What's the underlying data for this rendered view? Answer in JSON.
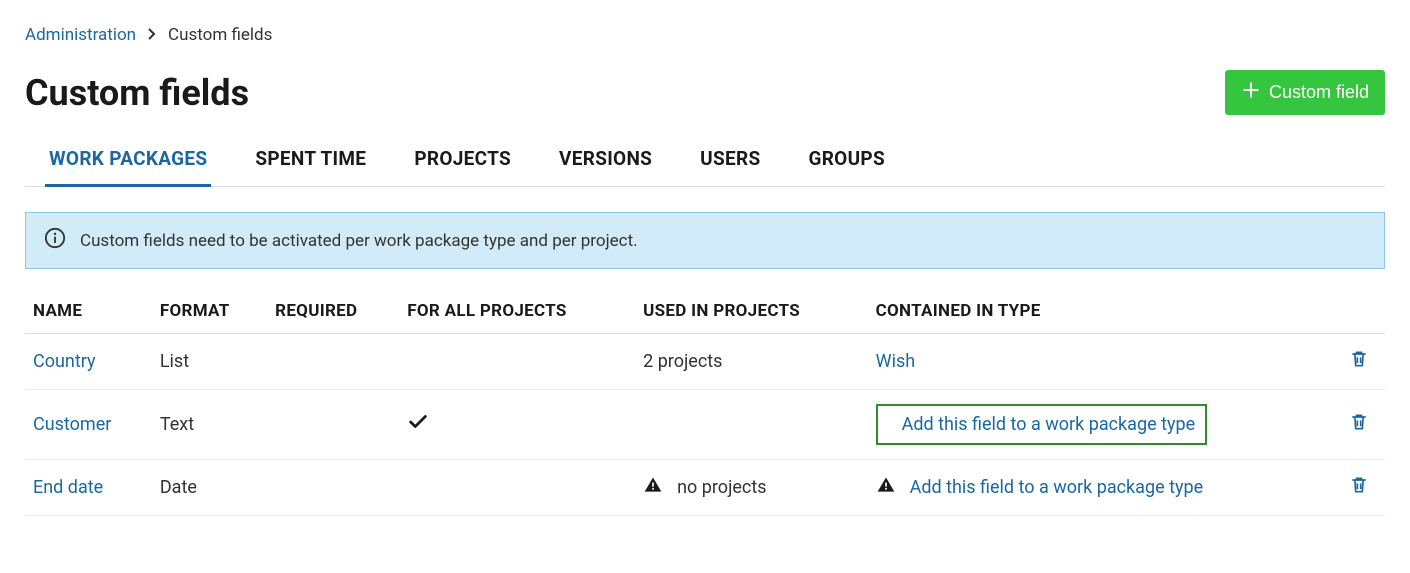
{
  "breadcrumb": {
    "parent": "Administration",
    "current": "Custom fields"
  },
  "page": {
    "title": "Custom fields",
    "add_button": "Custom field"
  },
  "tabs": [
    {
      "label": "WORK PACKAGES",
      "active": true
    },
    {
      "label": "SPENT TIME",
      "active": false
    },
    {
      "label": "PROJECTS",
      "active": false
    },
    {
      "label": "VERSIONS",
      "active": false
    },
    {
      "label": "USERS",
      "active": false
    },
    {
      "label": "GROUPS",
      "active": false
    }
  ],
  "banner": {
    "text": "Custom fields need to be activated per work package type and per project."
  },
  "table": {
    "headers": {
      "name": "NAME",
      "format": "FORMAT",
      "required": "REQUIRED",
      "for_all": "FOR ALL PROJECTS",
      "used_in": "USED IN PROJECTS",
      "contained_in": "CONTAINED IN TYPE"
    },
    "rows": [
      {
        "name": "Country",
        "format": "List",
        "required": false,
        "for_all": false,
        "used_in_text": "2 projects",
        "used_in_warning": false,
        "contained_link": "Wish",
        "contained_warning": false,
        "highlighted": false
      },
      {
        "name": "Customer",
        "format": "Text",
        "required": false,
        "for_all": true,
        "used_in_text": "",
        "used_in_warning": false,
        "contained_link": "Add this field to a work package type",
        "contained_warning": true,
        "highlighted": true
      },
      {
        "name": "End date",
        "format": "Date",
        "required": false,
        "for_all": false,
        "used_in_text": "no projects",
        "used_in_warning": true,
        "contained_link": "Add this field to a work package type",
        "contained_warning": true,
        "highlighted": false
      }
    ],
    "add_link_text": "Add this field to a work package type"
  }
}
